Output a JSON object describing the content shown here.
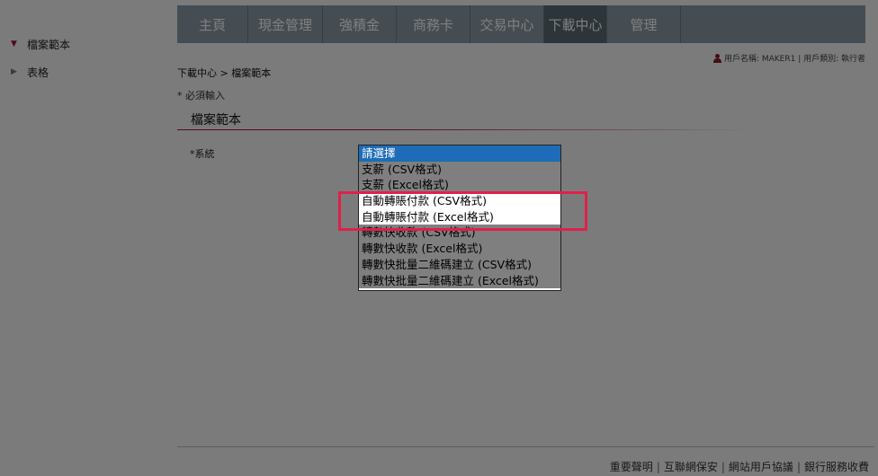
{
  "sidebar": {
    "items": [
      {
        "label": "檔案範本",
        "active": true
      },
      {
        "label": "表格",
        "active": false
      }
    ]
  },
  "nav": {
    "tabs": [
      {
        "label": "主頁"
      },
      {
        "label": "現金管理"
      },
      {
        "label": "強積金"
      },
      {
        "label": "商務卡"
      },
      {
        "label": "交易中心"
      },
      {
        "label": "下載中心",
        "active": true
      },
      {
        "label": "管理"
      }
    ]
  },
  "user": {
    "text": "用戶名稱: MAKER1 | 用戶類別: 執行者"
  },
  "breadcrumb": "下載中心 > 檔案範本",
  "required_note": "* 必須輸入",
  "section_title": "檔案範本",
  "field": {
    "label": "*系統"
  },
  "dropdown": {
    "options": [
      "請選擇",
      "支薪 (CSV格式)",
      "支薪 (Excel格式)",
      "自動轉賬付款 (CSV格式)",
      "自動轉賬付款 (Excel格式)",
      "轉數快收款 (CSV格式)",
      "轉數快收款 (Excel格式)",
      "轉數快批量二維碼建立 (CSV格式)",
      "轉數快批量二維碼建立 (Excel格式)"
    ],
    "selected_index": 0,
    "highlighted": [
      3,
      4
    ]
  },
  "footer": {
    "links": [
      "重要聲明",
      "互聯網保安",
      "網站用戶協議",
      "銀行服務收費"
    ]
  },
  "colors": {
    "accent": "#a0182f",
    "nav_bg": "#8a9aa6",
    "nav_active": "#5c6a74",
    "selected_option": "#1e6bb8",
    "highlight_border": "#e0204a"
  }
}
